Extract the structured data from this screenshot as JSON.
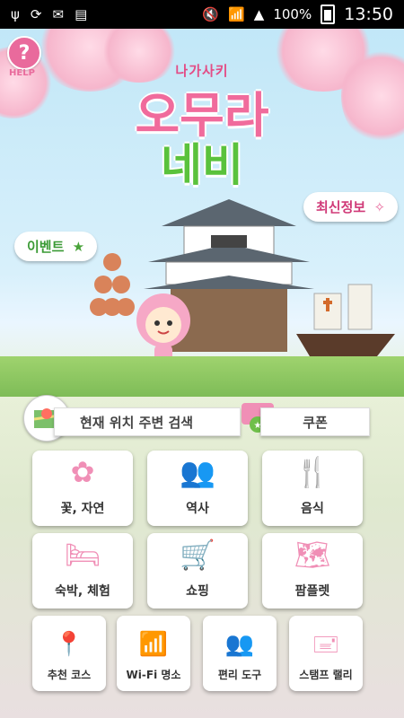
{
  "statusbar": {
    "left_icons": [
      "usb-icon",
      "sync-icon",
      "gmail-icon",
      "sim-icon"
    ],
    "battery": "100%",
    "time": "13:50"
  },
  "hero": {
    "help_label": "HELP",
    "subtitle": "나가사키",
    "title": "오무라",
    "title2": "네비",
    "event": "이벤트",
    "news": "최신정보"
  },
  "quick": {
    "search": "현재 위치 주변 검색",
    "coupon": "쿠폰"
  },
  "categories": {
    "flower": "꽃, 자연",
    "history": "역사",
    "food": "음식",
    "stay": "숙박, 체험",
    "shopping": "쇼핑",
    "pamphlet": "팜플렛",
    "course": "추천 코스",
    "wifi": "Wi-Fi 명소",
    "tools": "편리 도구",
    "stamp": "스탬프 랠리"
  },
  "colors": {
    "accent": "#f06b9c",
    "icon_pink": "#f08fb6",
    "green": "#5ac23c"
  }
}
